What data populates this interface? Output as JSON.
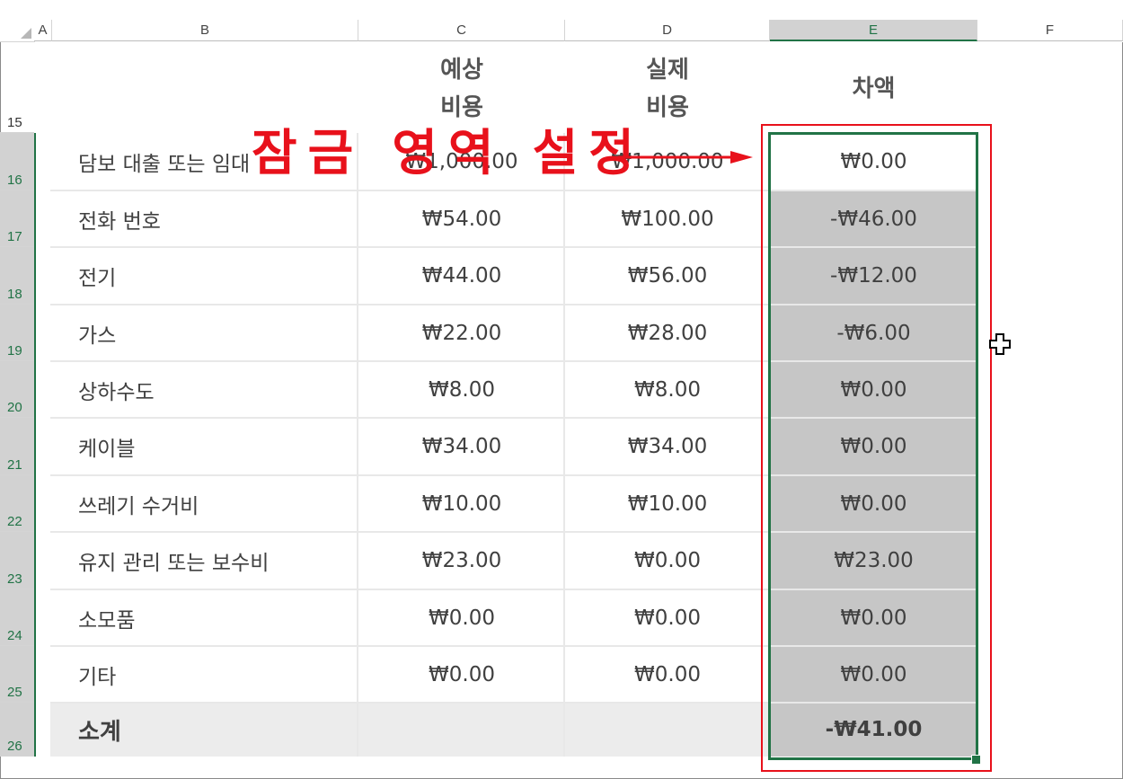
{
  "columns": [
    "A",
    "B",
    "C",
    "D",
    "E",
    "F"
  ],
  "active_column": "E",
  "row_numbers": [
    "15",
    "16",
    "17",
    "18",
    "19",
    "20",
    "21",
    "22",
    "23",
    "24",
    "25",
    "26"
  ],
  "header": {
    "budget_line1": "예상",
    "budget_line2": "비용",
    "actual_line1": "실제",
    "actual_line2": "비용",
    "diff": "차액"
  },
  "rows": [
    {
      "label": "담보 대출 또는 임대",
      "budget": "₩1,000.00",
      "actual": "₩1,000.00",
      "diff": "₩0.00"
    },
    {
      "label": "전화 번호",
      "budget": "₩54.00",
      "actual": "₩100.00",
      "diff": "-₩46.00"
    },
    {
      "label": "전기",
      "budget": "₩44.00",
      "actual": "₩56.00",
      "diff": "-₩12.00"
    },
    {
      "label": "가스",
      "budget": "₩22.00",
      "actual": "₩28.00",
      "diff": "-₩6.00"
    },
    {
      "label": "상하수도",
      "budget": "₩8.00",
      "actual": "₩8.00",
      "diff": "₩0.00"
    },
    {
      "label": "케이블",
      "budget": "₩34.00",
      "actual": "₩34.00",
      "diff": "₩0.00"
    },
    {
      "label": "쓰레기 수거비",
      "budget": "₩10.00",
      "actual": "₩10.00",
      "diff": "₩0.00"
    },
    {
      "label": "유지 관리 또는 보수비",
      "budget": "₩23.00",
      "actual": "₩0.00",
      "diff": "₩23.00"
    },
    {
      "label": "소모품",
      "budget": "₩0.00",
      "actual": "₩0.00",
      "diff": "₩0.00"
    },
    {
      "label": "기타",
      "budget": "₩0.00",
      "actual": "₩0.00",
      "diff": "₩0.00"
    }
  ],
  "total": {
    "label": "소계",
    "diff": "-₩41.00"
  },
  "annotation": "잠금 영역 설정",
  "colors": {
    "accent_green": "#217346",
    "annotation_red": "#e8111b",
    "selection_gray": "#c6c6c6"
  }
}
